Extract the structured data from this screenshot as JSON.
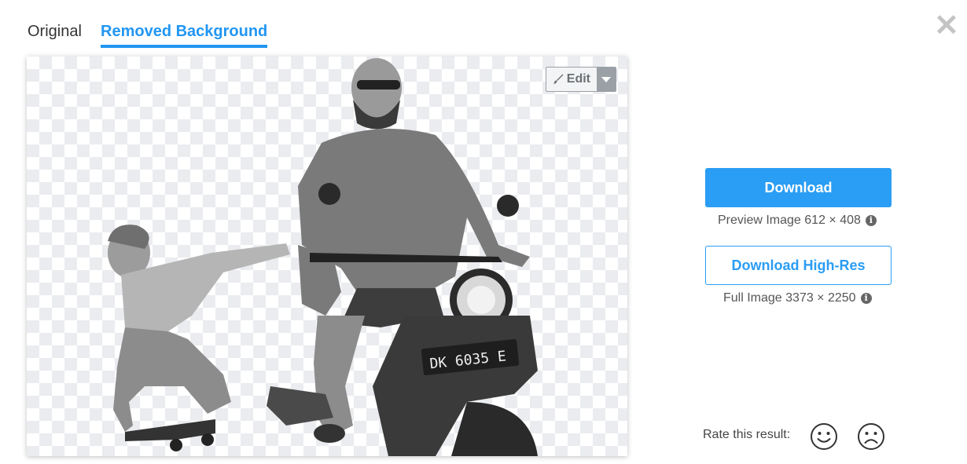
{
  "tabs": {
    "original": "Original",
    "removed": "Removed Background"
  },
  "close_icon": "close-icon",
  "preview": {
    "edit_label": "Edit",
    "edit_icon": "brush-icon",
    "dropdown_icon": "chevron-down-icon",
    "plate_text": "DK 6035 E"
  },
  "actions": {
    "download_label": "Download",
    "preview_caption": "Preview Image 612 × 408",
    "download_hires_label": "Download High-Res",
    "full_caption": "Full Image 3373 × 2250"
  },
  "rating": {
    "label": "Rate this result:",
    "positive_icon": "smiley-happy-icon",
    "negative_icon": "smiley-sad-icon"
  },
  "colors": {
    "accent": "#2a9df4",
    "checker": "#eaecef"
  }
}
